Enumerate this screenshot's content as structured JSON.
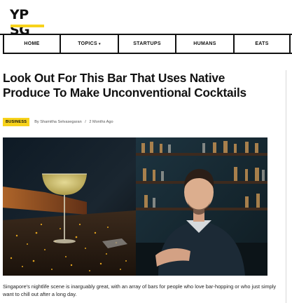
{
  "logo": {
    "text": "YP SG"
  },
  "nav": {
    "items": [
      {
        "label": "HOME"
      },
      {
        "label": "TOPICS",
        "caret": "▾"
      },
      {
        "label": "STARTUPS"
      },
      {
        "label": "HUMANS"
      },
      {
        "label": "EATS"
      }
    ]
  },
  "article": {
    "title": "Look Out For This Bar That Uses Native Produce To Make Unconventional Cocktails",
    "category": "BUSINESS",
    "author": "By Shamitha Selvasegaran",
    "separator": "/",
    "date": "2 Months Ago",
    "body": "Singapore's nightlife scene is inarguably great, with an array of bars for people who love bar-hopping or who just simply want to chill out after a long day."
  },
  "colors": {
    "accent": "#f7d21b",
    "text": "#111111",
    "rule": "#111111"
  }
}
